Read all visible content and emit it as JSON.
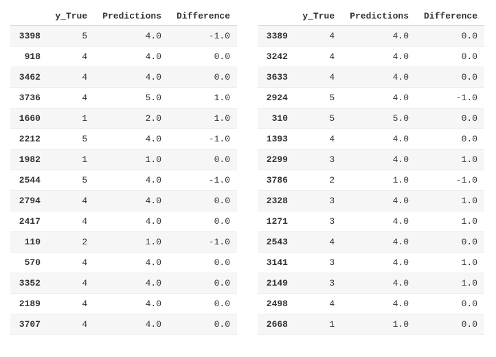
{
  "columns": {
    "y_true": "y_True",
    "predictions": "Predictions",
    "difference": "Difference"
  },
  "left": {
    "rows": [
      {
        "idx": "3398",
        "y_true": "5",
        "pred": "4.0",
        "diff": "-1.0"
      },
      {
        "idx": "918",
        "y_true": "4",
        "pred": "4.0",
        "diff": "0.0"
      },
      {
        "idx": "3462",
        "y_true": "4",
        "pred": "4.0",
        "diff": "0.0"
      },
      {
        "idx": "3736",
        "y_true": "4",
        "pred": "5.0",
        "diff": "1.0"
      },
      {
        "idx": "1660",
        "y_true": "1",
        "pred": "2.0",
        "diff": "1.0"
      },
      {
        "idx": "2212",
        "y_true": "5",
        "pred": "4.0",
        "diff": "-1.0"
      },
      {
        "idx": "1982",
        "y_true": "1",
        "pred": "1.0",
        "diff": "0.0"
      },
      {
        "idx": "2544",
        "y_true": "5",
        "pred": "4.0",
        "diff": "-1.0"
      },
      {
        "idx": "2794",
        "y_true": "4",
        "pred": "4.0",
        "diff": "0.0"
      },
      {
        "idx": "2417",
        "y_true": "4",
        "pred": "4.0",
        "diff": "0.0"
      },
      {
        "idx": "110",
        "y_true": "2",
        "pred": "1.0",
        "diff": "-1.0"
      },
      {
        "idx": "570",
        "y_true": "4",
        "pred": "4.0",
        "diff": "0.0"
      },
      {
        "idx": "3352",
        "y_true": "4",
        "pred": "4.0",
        "diff": "0.0"
      },
      {
        "idx": "2189",
        "y_true": "4",
        "pred": "4.0",
        "diff": "0.0"
      },
      {
        "idx": "3707",
        "y_true": "4",
        "pred": "4.0",
        "diff": "0.0"
      }
    ]
  },
  "right": {
    "rows": [
      {
        "idx": "3389",
        "y_true": "4",
        "pred": "4.0",
        "diff": "0.0"
      },
      {
        "idx": "3242",
        "y_true": "4",
        "pred": "4.0",
        "diff": "0.0"
      },
      {
        "idx": "3633",
        "y_true": "4",
        "pred": "4.0",
        "diff": "0.0"
      },
      {
        "idx": "2924",
        "y_true": "5",
        "pred": "4.0",
        "diff": "-1.0"
      },
      {
        "idx": "310",
        "y_true": "5",
        "pred": "5.0",
        "diff": "0.0"
      },
      {
        "idx": "1393",
        "y_true": "4",
        "pred": "4.0",
        "diff": "0.0"
      },
      {
        "idx": "2299",
        "y_true": "3",
        "pred": "4.0",
        "diff": "1.0"
      },
      {
        "idx": "3786",
        "y_true": "2",
        "pred": "1.0",
        "diff": "-1.0"
      },
      {
        "idx": "2328",
        "y_true": "3",
        "pred": "4.0",
        "diff": "1.0"
      },
      {
        "idx": "1271",
        "y_true": "3",
        "pred": "4.0",
        "diff": "1.0"
      },
      {
        "idx": "2543",
        "y_true": "4",
        "pred": "4.0",
        "diff": "0.0"
      },
      {
        "idx": "3141",
        "y_true": "3",
        "pred": "4.0",
        "diff": "1.0"
      },
      {
        "idx": "2149",
        "y_true": "3",
        "pred": "4.0",
        "diff": "1.0"
      },
      {
        "idx": "2498",
        "y_true": "4",
        "pred": "4.0",
        "diff": "0.0"
      },
      {
        "idx": "2668",
        "y_true": "1",
        "pred": "1.0",
        "diff": "0.0"
      }
    ]
  }
}
